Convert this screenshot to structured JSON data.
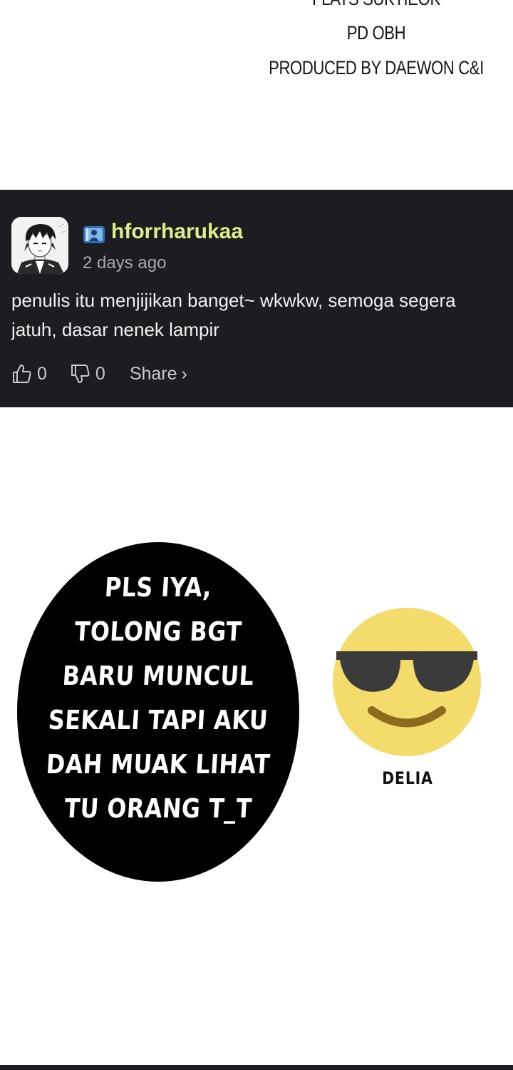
{
  "credits": {
    "cut_line": "FLATS SUKTIEOK",
    "pd": "PD OBH",
    "produced": "PRODUCED BY DAEWON C&I"
  },
  "comment": {
    "username": "hforrharukaa",
    "timestamp": "2 days ago",
    "body": "penulis itu menjijikan banget~ wkwkw, semoga segera jatuh, dasar nenek lampir",
    "likes": "0",
    "dislikes": "0",
    "share_label": "Share",
    "share_chevron": "›"
  },
  "bubble": {
    "lines": [
      "PLS IYA,",
      "TOLONG BGT",
      "BARU MUNCUL",
      "SEKALI TAPI AKU",
      "DAH MUAK LIHAT",
      "TU ORANG T_T"
    ]
  },
  "signature": "DELIA",
  "colors": {
    "card_bg": "#1c1c21",
    "username": "#e2ec8c",
    "emoji_face": "#f3dc6b"
  },
  "icons": {
    "like": "thumbs-up-icon",
    "dislike": "thumbs-down-icon",
    "badge": "user-badge-icon",
    "emoji": "sunglasses-emoji-icon"
  }
}
